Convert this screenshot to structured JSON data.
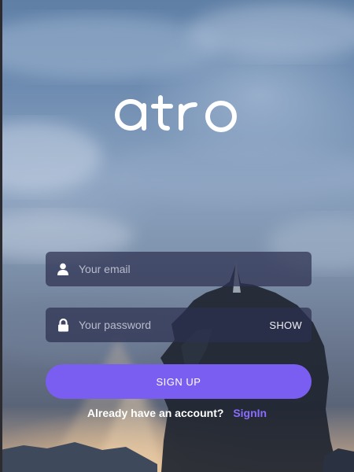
{
  "brand": {
    "logo_text": "atro"
  },
  "form": {
    "email": {
      "placeholder": "Your email",
      "value": "",
      "icon": "user-icon"
    },
    "password": {
      "placeholder": "Your password",
      "value": "",
      "icon": "lock-icon",
      "toggle_label": "SHOW"
    },
    "signup_label": "SIGN UP"
  },
  "footer": {
    "prompt": "Already have an account?",
    "signin_label": "SignIn"
  },
  "colors": {
    "accent": "#7a5ef2",
    "link": "#8a6cff",
    "field_bg": "#2d3050"
  }
}
